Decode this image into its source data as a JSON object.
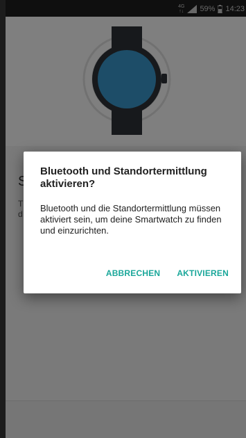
{
  "status_bar": {
    "network_type": "4G",
    "network_sub": "↑↓",
    "battery_percent": "59%",
    "time": "14:23",
    "icons": [
      "signal-icon",
      "battery-icon"
    ]
  },
  "hero": {
    "image": "smartwatch-icon"
  },
  "background": {
    "heading": "S",
    "body_line_1": "T",
    "body_line_2": "d"
  },
  "dialog": {
    "title": "Bluetooth und Standortermittlung aktivieren?",
    "message": "Bluetooth und die Standortermittlung müssen aktiviert sein, um deine Smartwatch zu finden und einzurichten.",
    "cancel_label": "ABBRECHEN",
    "confirm_label": "AKTIVIEREN"
  },
  "colors": {
    "accent": "#1aa79a",
    "watch_face": "#3a9bd0",
    "watch_body": "#2f3338",
    "status_bar": "#1f1f1f"
  }
}
